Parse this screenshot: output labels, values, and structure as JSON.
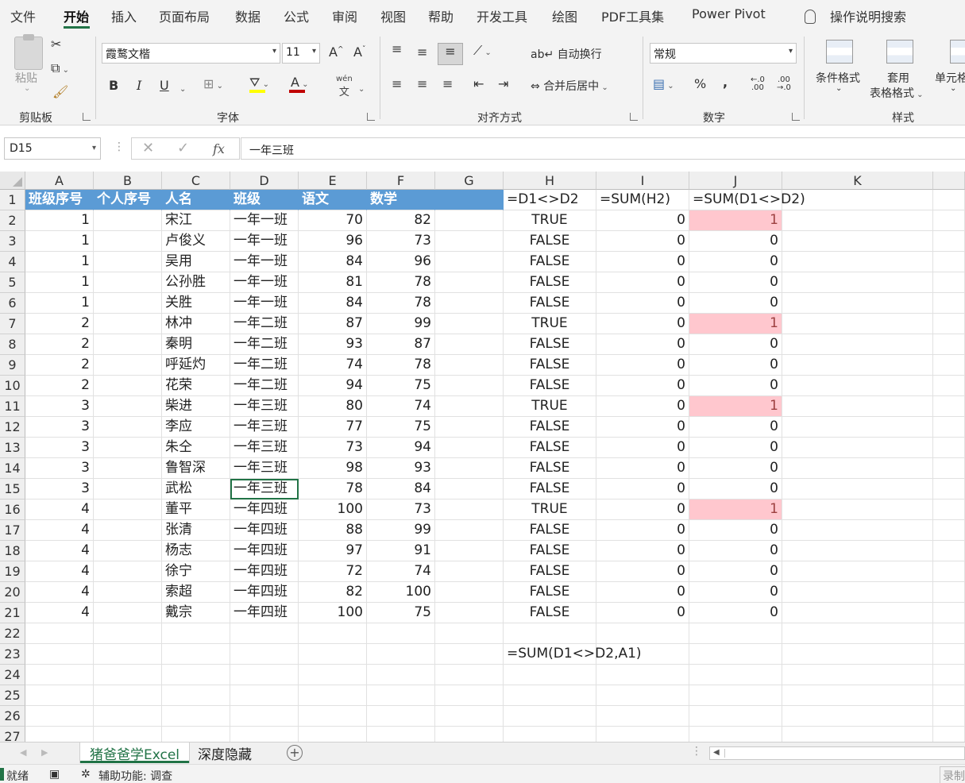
{
  "ribbon_tabs": [
    "文件",
    "开始",
    "插入",
    "页面布局",
    "数据",
    "公式",
    "审阅",
    "视图",
    "帮助",
    "开发工具",
    "绘图",
    "PDF工具集",
    "Power Pivot"
  ],
  "tell_me": "操作说明搜索",
  "clipboard": {
    "paste": "粘贴",
    "group": "剪贴板"
  },
  "font": {
    "name": "霞鹜文楷",
    "size": "11",
    "group": "字体",
    "bold": "B",
    "italic": "I",
    "underline": "U",
    "grow": "A",
    "shrink": "A",
    "color_letter": "A",
    "phonetic": "wén"
  },
  "alignment": {
    "wrap": "自动换行",
    "merge": "合并后居中",
    "group": "对齐方式"
  },
  "number": {
    "format": "常规",
    "percent": "%",
    "comma": "\t,",
    "group": "数字",
    "inc_dec": "←.0 .00",
    "dec_dec": ".00 →.0"
  },
  "styles": {
    "conditional": "条件格式",
    "table_line1": "套用",
    "table_line2": "表格格式",
    "cell_styles": "单元格",
    "group": "样式"
  },
  "formula_bar": {
    "name_box": "D15",
    "fx": "fx",
    "value": "一年三班"
  },
  "columns": [
    "A",
    "B",
    "C",
    "D",
    "E",
    "F",
    "G",
    "H",
    "I",
    "J",
    "K"
  ],
  "rows": [
    [
      "班级序号",
      "个人序号",
      "人名",
      "班级",
      "语文",
      "数学",
      "",
      "=D1<>D2",
      "=SUM(H2)",
      "=SUM(D1<>D2)",
      ""
    ],
    [
      "1",
      "",
      "宋江",
      "一年一班",
      "70",
      "82",
      "",
      "TRUE",
      "0",
      "1",
      ""
    ],
    [
      "1",
      "",
      "卢俊义",
      "一年一班",
      "96",
      "73",
      "",
      "FALSE",
      "0",
      "0",
      ""
    ],
    [
      "1",
      "",
      "吴用",
      "一年一班",
      "84",
      "96",
      "",
      "FALSE",
      "0",
      "0",
      ""
    ],
    [
      "1",
      "",
      "公孙胜",
      "一年一班",
      "81",
      "78",
      "",
      "FALSE",
      "0",
      "0",
      ""
    ],
    [
      "1",
      "",
      "关胜",
      "一年一班",
      "84",
      "78",
      "",
      "FALSE",
      "0",
      "0",
      ""
    ],
    [
      "2",
      "",
      "林冲",
      "一年二班",
      "87",
      "99",
      "",
      "TRUE",
      "0",
      "1",
      ""
    ],
    [
      "2",
      "",
      "秦明",
      "一年二班",
      "93",
      "87",
      "",
      "FALSE",
      "0",
      "0",
      ""
    ],
    [
      "2",
      "",
      "呼延灼",
      "一年二班",
      "74",
      "78",
      "",
      "FALSE",
      "0",
      "0",
      ""
    ],
    [
      "2",
      "",
      "花荣",
      "一年二班",
      "94",
      "75",
      "",
      "FALSE",
      "0",
      "0",
      ""
    ],
    [
      "3",
      "",
      "柴进",
      "一年三班",
      "80",
      "74",
      "",
      "TRUE",
      "0",
      "1",
      ""
    ],
    [
      "3",
      "",
      "李应",
      "一年三班",
      "77",
      "75",
      "",
      "FALSE",
      "0",
      "0",
      ""
    ],
    [
      "3",
      "",
      "朱仝",
      "一年三班",
      "73",
      "94",
      "",
      "FALSE",
      "0",
      "0",
      ""
    ],
    [
      "3",
      "",
      "鲁智深",
      "一年三班",
      "98",
      "93",
      "",
      "FALSE",
      "0",
      "0",
      ""
    ],
    [
      "3",
      "",
      "武松",
      "一年三班",
      "78",
      "84",
      "",
      "FALSE",
      "0",
      "0",
      ""
    ],
    [
      "4",
      "",
      "董平",
      "一年四班",
      "100",
      "73",
      "",
      "TRUE",
      "0",
      "1",
      ""
    ],
    [
      "4",
      "",
      "张清",
      "一年四班",
      "88",
      "99",
      "",
      "FALSE",
      "0",
      "0",
      ""
    ],
    [
      "4",
      "",
      "杨志",
      "一年四班",
      "97",
      "91",
      "",
      "FALSE",
      "0",
      "0",
      ""
    ],
    [
      "4",
      "",
      "徐宁",
      "一年四班",
      "72",
      "74",
      "",
      "FALSE",
      "0",
      "0",
      ""
    ],
    [
      "4",
      "",
      "索超",
      "一年四班",
      "82",
      "100",
      "",
      "FALSE",
      "0",
      "0",
      ""
    ],
    [
      "4",
      "",
      "戴宗",
      "一年四班",
      "100",
      "75",
      "",
      "FALSE",
      "0",
      "0",
      ""
    ],
    [
      "",
      "",
      "",
      "",
      "",
      "",
      "",
      "",
      "",
      "",
      ""
    ],
    [
      "",
      "",
      "",
      "",
      "",
      "",
      "",
      "=SUM(D1<>D2,A1)",
      "",
      "",
      ""
    ],
    [
      "",
      "",
      "",
      "",
      "",
      "",
      "",
      "",
      "",
      "",
      ""
    ],
    [
      "",
      "",
      "",
      "",
      "",
      "",
      "",
      "",
      "",
      "",
      ""
    ],
    [
      "",
      "",
      "",
      "",
      "",
      "",
      "",
      "",
      "",
      "",
      ""
    ],
    [
      "",
      "",
      "",
      "",
      "",
      "",
      "",
      "",
      "",
      "",
      ""
    ]
  ],
  "highlight_color": "#ffc7ce",
  "header_fill": "#5b9bd5",
  "accent": "#217346",
  "sheet_tabs": [
    "猪爸爸学Excel",
    "深度隐藏"
  ],
  "add_sheet": "+",
  "status": {
    "ready": "就绪",
    "accessibility": "辅助功能: 调查",
    "record": "录制"
  }
}
